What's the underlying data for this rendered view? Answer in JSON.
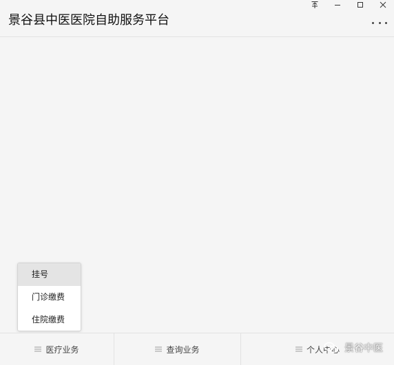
{
  "window": {
    "title": "景谷县中医医院自助服务平台",
    "controls": [
      "pin-icon",
      "minimize-icon",
      "maximize-icon",
      "close-icon"
    ]
  },
  "popup_menu": {
    "items": [
      {
        "label": "挂号",
        "active": true
      },
      {
        "label": "门诊缴费",
        "active": false
      },
      {
        "label": "住院缴费",
        "active": false
      }
    ]
  },
  "tabbar": {
    "tabs": [
      {
        "label": "医疗业务",
        "icon": "menu-icon"
      },
      {
        "label": "查询业务",
        "icon": "menu-icon"
      },
      {
        "label": "个人中心",
        "icon": "menu-icon"
      }
    ]
  },
  "watermark": {
    "text": "景谷中医",
    "icon": "wechat-logo-icon"
  },
  "colors": {
    "background": "#f5f5f5",
    "divider": "#e2e2e2",
    "active_item": "#e4e4e4"
  }
}
